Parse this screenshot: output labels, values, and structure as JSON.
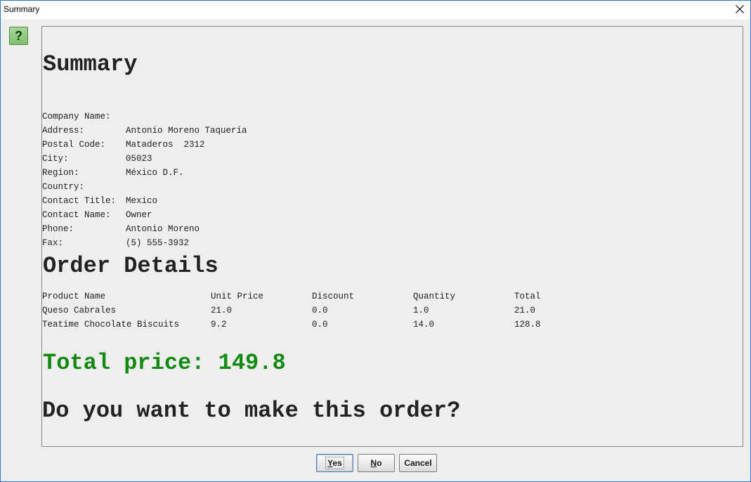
{
  "window": {
    "title": "Summary",
    "close_symbol": "×"
  },
  "help_icon": {
    "symbol": "?",
    "name": "help-icon"
  },
  "summary": {
    "heading": "Summary",
    "fields": [
      {
        "label": "Company Name:",
        "value": "Antonio Moreno Taquería"
      },
      {
        "label": "Address:",
        "value": "Mataderos  2312"
      },
      {
        "label": "Postal Code:",
        "value": "05023"
      },
      {
        "label": "City:",
        "value": "México D.F."
      },
      {
        "label": "Region:",
        "value": ""
      },
      {
        "label": "Country:",
        "value": "Mexico"
      },
      {
        "label": "Contact Title:",
        "value": "Owner"
      },
      {
        "label": "Contact Name:",
        "value": "Antonio Moreno"
      },
      {
        "label": "Phone:",
        "value": "(5) 555-3932"
      },
      {
        "label": "Fax:",
        "value": ""
      }
    ]
  },
  "order": {
    "heading": "Order Details",
    "columns": [
      "Product Name",
      "Unit Price",
      "Discount",
      "Quantity",
      "Total"
    ],
    "rows": [
      [
        "Queso Cabrales",
        "21.0",
        "0.0",
        "1.0",
        "21.0"
      ],
      [
        "Teatime Chocolate Biscuits",
        "9.2",
        "0.0",
        "14.0",
        "128.8"
      ]
    ]
  },
  "total_line": "Total price: 149.8",
  "question": "Do you want to make this order?",
  "buttons": {
    "yes": "Yes",
    "no": "No",
    "cancel": "Cancel"
  },
  "colors": {
    "total_green": "#128a12",
    "window_border": "#2b79d9",
    "help_green": "#7fbe6c"
  }
}
